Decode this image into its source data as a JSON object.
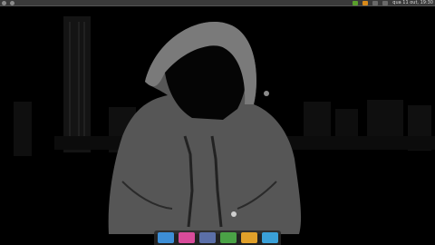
{
  "topbar": {
    "clock": "qua 11 out, 19:30"
  },
  "dock": {
    "items": [
      {
        "name": "apps",
        "color": "#3d8ed6"
      },
      {
        "name": "folder",
        "color": "#d84b9a"
      },
      {
        "name": "files",
        "color": "#5b6fa8"
      },
      {
        "name": "home",
        "color": "#4aa246"
      },
      {
        "name": "settings",
        "color": "#e0a02a"
      },
      {
        "name": "browser",
        "color": "#3aa0d8"
      }
    ]
  },
  "colors": {
    "background": "#000000",
    "panel": "#3a3a3a"
  }
}
